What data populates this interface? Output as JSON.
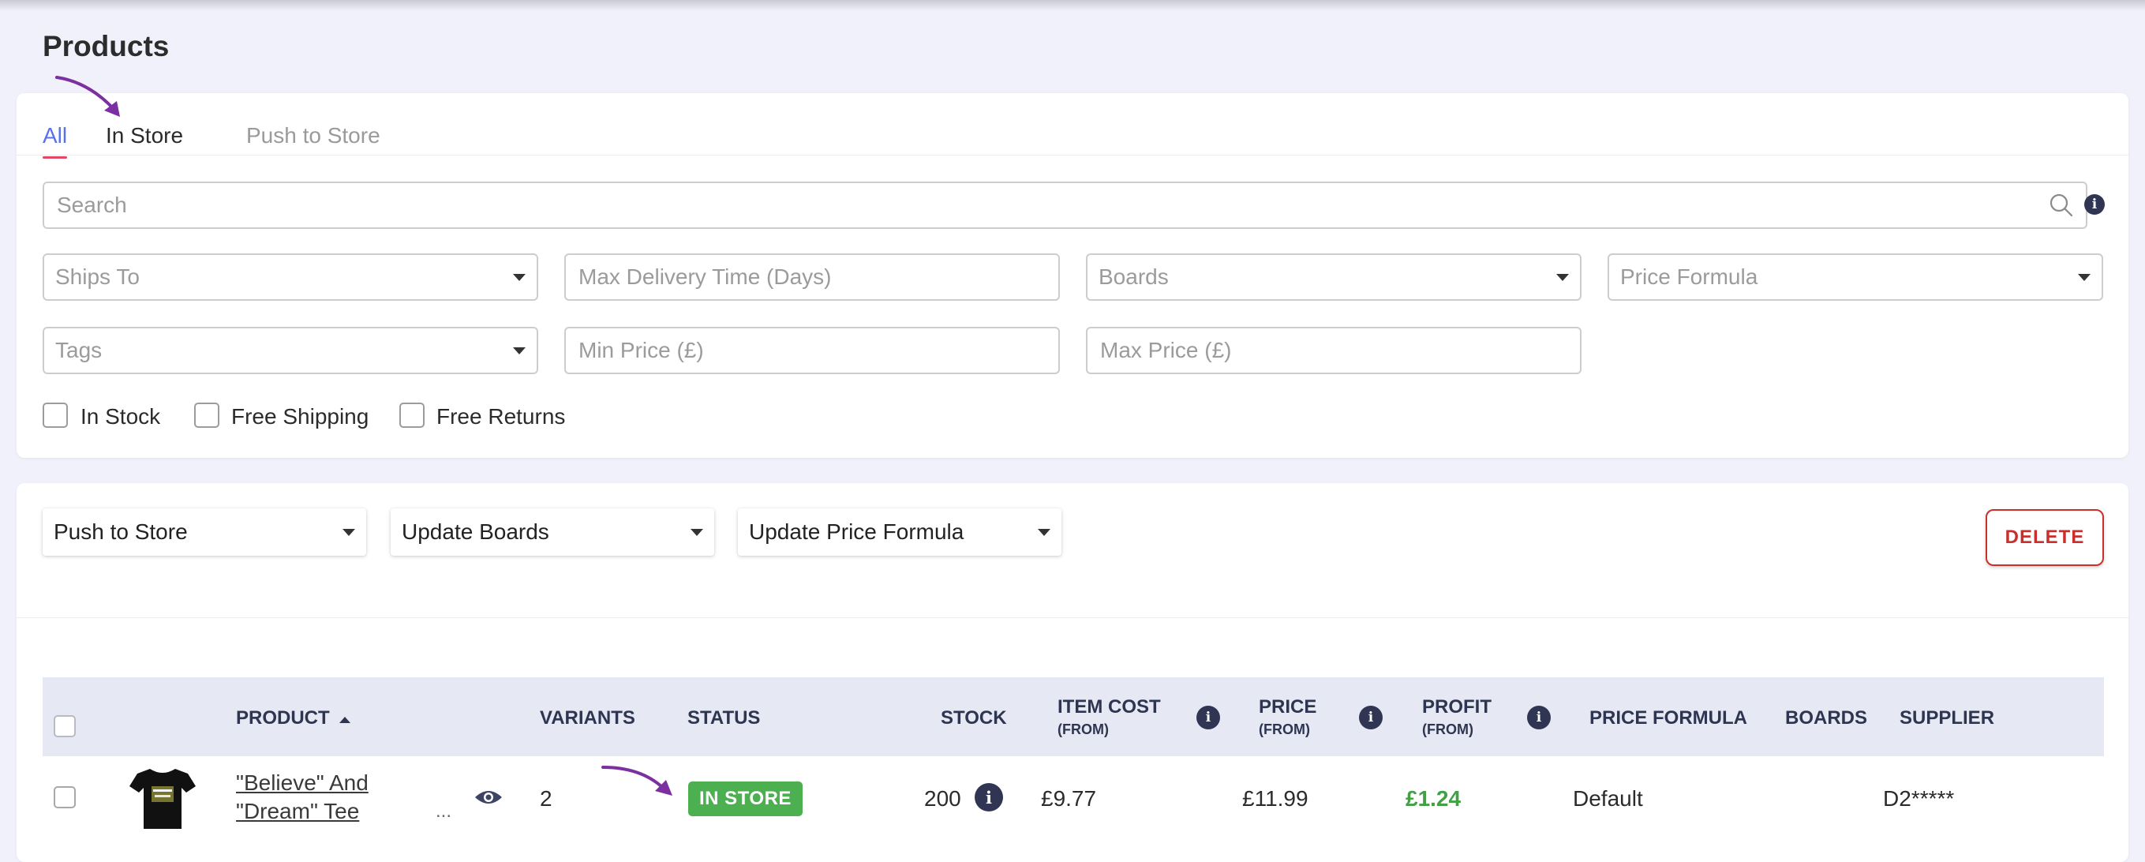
{
  "page": {
    "title": "Products"
  },
  "tabs": [
    {
      "label": "All",
      "active": true
    },
    {
      "label": "In Store",
      "active": false
    },
    {
      "label": "Push to Store",
      "active": false
    }
  ],
  "filters": {
    "search_placeholder": "Search",
    "ships_to": "Ships To",
    "max_delivery": "Max Delivery Time (Days)",
    "boards": "Boards",
    "price_formula": "Price Formula",
    "tags": "Tags",
    "min_price": "Min Price (£)",
    "max_price": "Max Price (£)",
    "checkboxes": [
      {
        "label": "In Stock",
        "checked": false
      },
      {
        "label": "Free Shipping",
        "checked": false
      },
      {
        "label": "Free Returns",
        "checked": false
      }
    ]
  },
  "actions": {
    "push_to_store": "Push to Store",
    "update_boards": "Update Boards",
    "update_price_formula": "Update Price Formula",
    "delete": "DELETE"
  },
  "table": {
    "columns": {
      "product": "PRODUCT",
      "variants": "VARIANTS",
      "status": "STATUS",
      "stock": "STOCK",
      "item_cost": "ITEM COST",
      "item_cost_sub": "(FROM)",
      "price": "PRICE",
      "price_sub": "(FROM)",
      "profit": "PROFIT",
      "profit_sub": "(FROM)",
      "price_formula": "PRICE FORMULA",
      "boards": "BOARDS",
      "supplier": "SUPPLIER"
    },
    "rows": [
      {
        "product_line1": "\"Believe\" And",
        "product_line2": "\"Dream\" Tee",
        "ellipsis": "...",
        "variants": "2",
        "status": "IN STORE",
        "stock": "200",
        "item_cost": "£9.77",
        "price": "£11.99",
        "profit": "£1.24",
        "price_formula": "Default",
        "boards": "",
        "supplier": "D2*****"
      }
    ]
  },
  "colors": {
    "accent": "#5a72e8",
    "tab_underline": "#e04864",
    "status_green": "#4caf50",
    "delete_red": "#c9302c",
    "annotation_arrow": "#7b2fa0"
  },
  "info_glyph": "i"
}
